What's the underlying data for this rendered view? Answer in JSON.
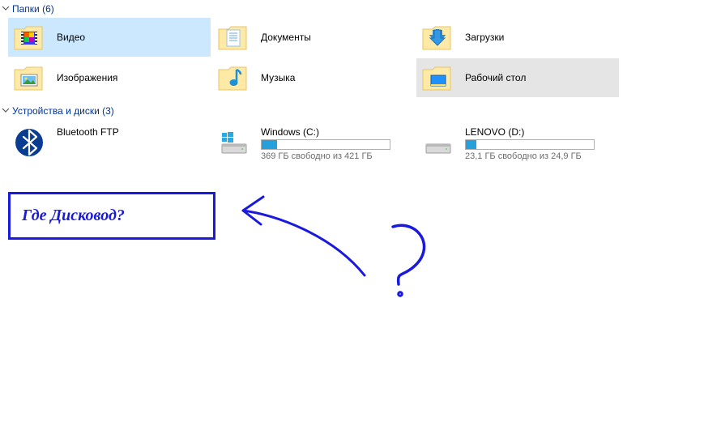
{
  "sections": {
    "folders": {
      "title": "Папки (6)",
      "items": [
        {
          "name": "Видео",
          "icon": "video",
          "state": "selected"
        },
        {
          "name": "Документы",
          "icon": "documents",
          "state": ""
        },
        {
          "name": "Загрузки",
          "icon": "downloads",
          "state": ""
        },
        {
          "name": "Изображения",
          "icon": "pictures",
          "state": ""
        },
        {
          "name": "Музыка",
          "icon": "music",
          "state": ""
        },
        {
          "name": "Рабочий стол",
          "icon": "desktop",
          "state": "hover"
        }
      ]
    },
    "devices": {
      "title": "Устройства и диски (3)",
      "items": [
        {
          "name": "Bluetooth FTP",
          "icon": "bluetooth",
          "bar": null,
          "free": ""
        },
        {
          "name": "Windows (C:)",
          "icon": "drive-windows",
          "bar": 12,
          "free": "369 ГБ свободно из 421 ГБ"
        },
        {
          "name": "LENOVO (D:)",
          "icon": "drive",
          "bar": 8,
          "free": "23,1 ГБ свободно из 24,9 ГБ"
        }
      ]
    }
  },
  "annotation": {
    "text": "Где Дисковод?"
  },
  "colors": {
    "annotation": "#1a1adf",
    "headerText": "#003399",
    "selectedBg": "#cce8ff",
    "hoverBg": "#e5e5e5",
    "barFill": "#26a0da"
  }
}
